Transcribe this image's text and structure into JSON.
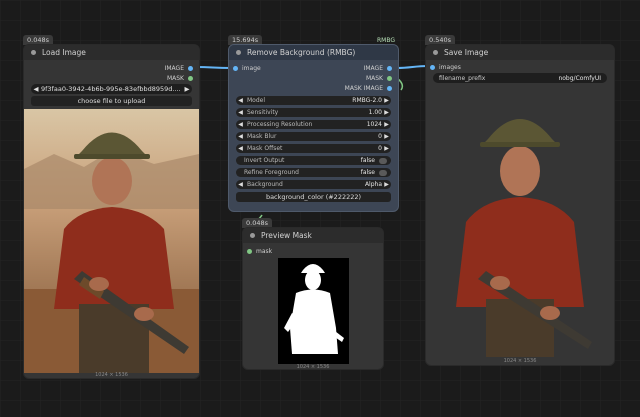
{
  "colors": {
    "image_socket": "#64b5f6",
    "mask_socket": "#81c784",
    "wire": "#64b5f6"
  },
  "load_image": {
    "time": "0.048s",
    "title": "Load Image",
    "outputs": [
      "IMAGE",
      "MASK"
    ],
    "file_value": "9f3faa0-3942-4b6b-995e-83efbbd8959d....",
    "upload_label": "choose file to upload",
    "size": "1024 × 1536"
  },
  "rmbg": {
    "time": "15.694s",
    "badge": "RMBG",
    "title": "Remove Background (RMBG)",
    "input": "image",
    "outputs": [
      "IMAGE",
      "MASK",
      "MASK IMAGE"
    ],
    "widgets": [
      {
        "label": "Model",
        "value": "RMBG-2.0"
      },
      {
        "label": "Sensitivity",
        "value": "1.00"
      },
      {
        "label": "Processing Resolution",
        "value": "1024"
      },
      {
        "label": "Mask Blur",
        "value": "0"
      },
      {
        "label": "Mask Offset",
        "value": "0"
      },
      {
        "label": "Invert Output",
        "value": "false"
      },
      {
        "label": "Refine Foreground",
        "value": "false"
      },
      {
        "label": "Background",
        "value": "Alpha"
      }
    ],
    "color_button": "background_color (#222222)"
  },
  "preview_mask": {
    "time": "0.048s",
    "title": "Preview Mask",
    "input": "mask",
    "size": "1024 × 1536"
  },
  "save_image": {
    "time": "0.540s",
    "title": "Save Image",
    "input": "images",
    "prefix_label": "filename_prefix",
    "prefix_value": "nobg/ComfyUI",
    "size": "1024 × 1536"
  }
}
